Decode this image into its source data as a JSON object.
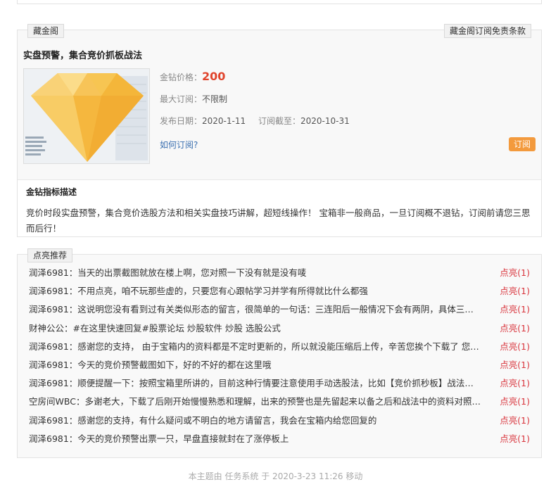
{
  "vault": {
    "tag": "藏金阁",
    "terms_link": "藏金阁订阅免责条款",
    "product_title": "实盘预警，集合竞价抓板战法",
    "price_label": "金钻价格：",
    "price_value": "200",
    "max_sub_label": "最大订阅：",
    "max_sub_value": "不限制",
    "publish_label": "发布日期：",
    "publish_value": "2020-1-11",
    "deadline_label": "订阅截至：",
    "deadline_value": "2020-10-31",
    "how_to_subscribe": "如何订阅?",
    "subscribe_button": "订阅",
    "desc_title": "金钻指标描述",
    "desc_text": "竞价时段实盘预警，集合竞价选股方法和相关实盘技巧讲解，超短线操作！ 宝箱非一般商品，一旦订阅概不退钻，订阅前请您三思而后行！"
  },
  "reco": {
    "tag": "点亮推荐",
    "items": [
      {
        "text": "润泽6981：当天的出票截图就放在楼上啊，您对照一下没有就是没有唛",
        "count": "点亮(1)"
      },
      {
        "text": "润泽6981：不用点亮，咱不玩那些虚的，只要您有心跟帖学习并学有所得就比什么都强",
        "count": "点亮(1)"
      },
      {
        "text": "润泽6981：这说明您没有看到过有关类似形态的留言，很简单的一句话：三连阳后一般情况下会有两阴，具体三连阳都...",
        "count": "点亮(1)"
      },
      {
        "text": "财神公公：#在这里快速回复#股票论坛 炒股软件 炒股 选股公式",
        "count": "点亮(1)"
      },
      {
        "text": "润泽6981：感谢您的支持， 由于宝箱内的资料都是不定时更新的，所以就没能压缩后上传，辛苦您挨个下载了 您所 ...",
        "count": "点亮(1)"
      },
      {
        "text": "润泽6981：今天的竞价预警截图如下，好的不好的都在这里哦",
        "count": "点亮(1)"
      },
      {
        "text": "润泽6981：顺便提醒一下：按照宝箱里所讲的，目前这种行情要注意使用手动选股法，比如【竞价抓秒板】战法，记得...",
        "count": "点亮(1)"
      },
      {
        "text": "空房间WBC：多谢老大，下载了后刚开始慢慢熟悉和理解，出来的预警也是先留起来以备之后和战法中的资料对照印证...",
        "count": "点亮(1)"
      },
      {
        "text": "润泽6981：感谢您的支持，有什么疑问或不明白的地方请留言，我会在宝箱内给您回复的",
        "count": "点亮(1)"
      },
      {
        "text": "润泽6981：今天的竞价预警出票一只，早盘直接就封在了涨停板上",
        "count": "点亮(1)"
      }
    ]
  },
  "footer": {
    "note": "本主题由 任务系统 于 2020-3-23 11:26 移动"
  },
  "colors": {
    "price": "#e0442c",
    "accent_button": "#f39a3d",
    "link": "#3a6fb0",
    "light_count": "#d9363e"
  },
  "icons": {
    "thumbnail": "diamond-screenshot-icon"
  }
}
